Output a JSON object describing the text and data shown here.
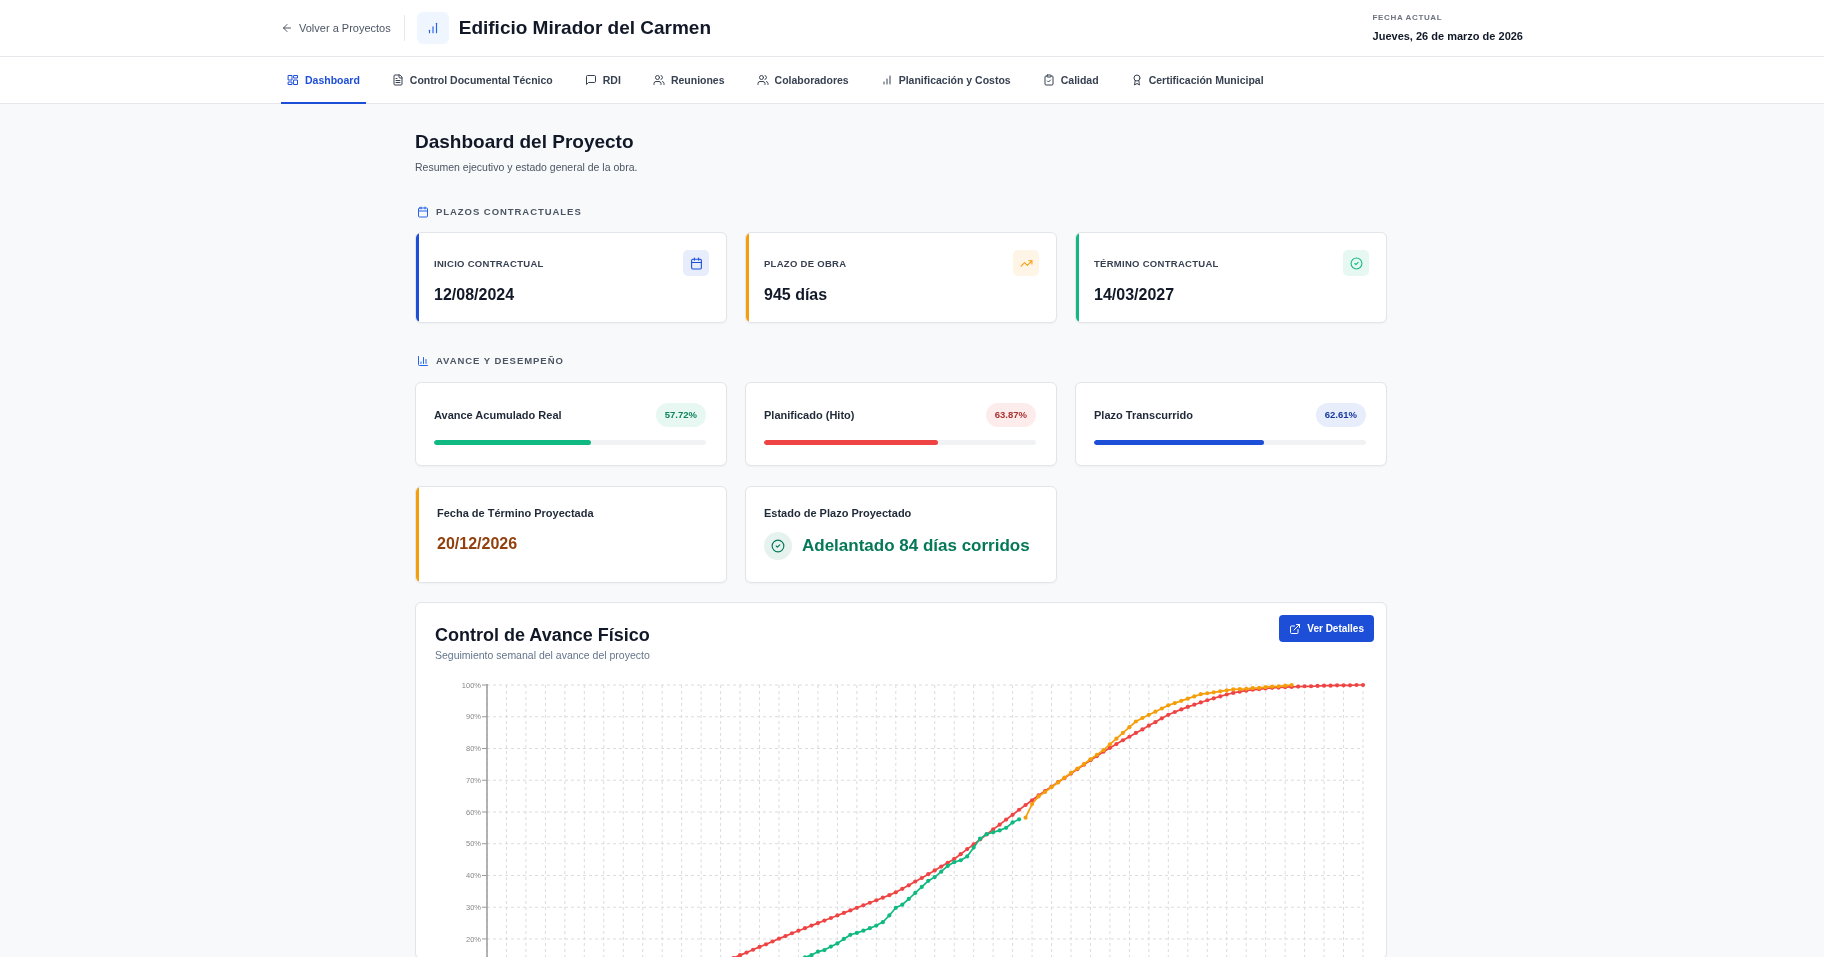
{
  "header": {
    "back_link": "Volver a Proyectos",
    "title": "Edificio Mirador del Carmen",
    "date_label": "FECHA ACTUAL",
    "date": "Jueves, 26 de marzo de 2026"
  },
  "tabs": [
    {
      "label": "Dashboard",
      "selected": true
    },
    {
      "label": "Control Documental Técnico",
      "selected": false
    },
    {
      "label": "RDI",
      "selected": false
    },
    {
      "label": "Reuniones",
      "selected": false
    },
    {
      "label": "Colaboradores",
      "selected": false
    },
    {
      "label": "Planificación y Costos",
      "selected": false
    },
    {
      "label": "Calidad",
      "selected": false
    },
    {
      "label": "Certificación Municipal",
      "selected": false
    }
  ],
  "page": {
    "title": "Dashboard del Proyecto",
    "subtitle": "Resumen ejecutivo y estado general de la obra."
  },
  "contract_terms": {
    "heading": "PLAZOS CONTRACTUALES",
    "cards": [
      {
        "label": "INICIO CONTRACTUAL",
        "value": "12/08/2024",
        "color": "#1d4ed8"
      },
      {
        "label": "PLAZO DE OBRA",
        "value": "945 días",
        "color": "#f59e0b"
      },
      {
        "label": "TÉRMINO CONTRACTUAL",
        "value": "14/03/2027",
        "color": "#10b981"
      }
    ]
  },
  "performance": {
    "heading": "AVANCE Y DESEMPEÑO",
    "metrics": [
      {
        "label": "Avance Acumulado Real",
        "reading": "57.72%",
        "level": 0.5772,
        "color": "#10b981"
      },
      {
        "label": "Planificado (Hito)",
        "reading": "63.87%",
        "level": 0.6387,
        "color": "#ef4444"
      },
      {
        "label": "Plazo Transcurrido",
        "reading": "62.61%",
        "level": 0.6261,
        "color": "#1d4ed8"
      }
    ],
    "projection": [
      {
        "kind": "date",
        "label": "Fecha de Término Proyectada",
        "value": "20/12/2026",
        "color": "#f59e0b"
      },
      {
        "kind": "status",
        "label": "Estado de Plazo Proyectado",
        "value": "Adelantado 84 días corridos",
        "color": "#047857"
      }
    ]
  },
  "progress_chart": {
    "title": "Control de Avance Físico",
    "subtitle": "Seguimiento semanal del avance del proyecto",
    "button": "Ver Detalles",
    "chart_data": {
      "type": "line",
      "grid": true,
      "categories": [
        null,
        null,
        null,
        null,
        null,
        null,
        null,
        null,
        null,
        null,
        null,
        null,
        null,
        null,
        null,
        null,
        null,
        null,
        null,
        null,
        null,
        null,
        null,
        null,
        null,
        null,
        null,
        null,
        null,
        null,
        null,
        null,
        null,
        null,
        null,
        null,
        null,
        null,
        null,
        null,
        null,
        null,
        null,
        null,
        null,
        null,
        null,
        null,
        null,
        null,
        null,
        null,
        null,
        null,
        null,
        null,
        null,
        null,
        null,
        null,
        null,
        null,
        null,
        null,
        null,
        null,
        null,
        null,
        null,
        null,
        null,
        null,
        null,
        null,
        null,
        null,
        null,
        null,
        null,
        null,
        null,
        null,
        null,
        null,
        null,
        null,
        null,
        null,
        null,
        null,
        null,
        null,
        null,
        null,
        null,
        null,
        null,
        null,
        null,
        null,
        null,
        null,
        null,
        null,
        null,
        null,
        null,
        null,
        null,
        null,
        null,
        null,
        null,
        null,
        null,
        null,
        null,
        null,
        null,
        null,
        null,
        null,
        null,
        null,
        null,
        null,
        null,
        null,
        null,
        null,
        null,
        null,
        null,
        null,
        null,
        null
      ],
      "ylim": [
        14,
        100
      ],
      "yticks": [
        {
          "value": 20,
          "label": "20%"
        },
        {
          "value": 30,
          "label": "30%"
        },
        {
          "value": 40,
          "label": "40%"
        },
        {
          "value": 50,
          "label": "50%"
        },
        {
          "value": 60,
          "label": "60%"
        },
        {
          "value": 70,
          "label": "70%"
        },
        {
          "value": 80,
          "label": "80%"
        },
        {
          "value": 90,
          "label": "90%"
        },
        {
          "value": 100,
          "label": "100%"
        }
      ],
      "series": [
        {
          "color": "#ef4444",
          "values": [
            null,
            null,
            null,
            null,
            null,
            null,
            null,
            null,
            null,
            null,
            null,
            null,
            null,
            null,
            null,
            null,
            null,
            null,
            null,
            null,
            null,
            null,
            null,
            null,
            null,
            null,
            null,
            null,
            null,
            null,
            null,
            null,
            null,
            null,
            null,
            null,
            null,
            null,
            14.0,
            14.9,
            15.7,
            16.6,
            17.5,
            18.3,
            19.2,
            20.1,
            20.9,
            21.8,
            22.6,
            23.4,
            24.2,
            25.0,
            25.8,
            26.6,
            27.4,
            28.2,
            29.0,
            29.8,
            30.6,
            31.4,
            32.2,
            33.0,
            33.8,
            34.7,
            35.8,
            36.9,
            38.1,
            39.2,
            40.4,
            41.6,
            42.8,
            44.0,
            45.2,
            46.7,
            48.3,
            49.8,
            51.4,
            52.9,
            54.5,
            56.0,
            57.6,
            59.1,
            60.7,
            62.2,
            63.7,
            65.2,
            66.6,
            68.0,
            69.4,
            70.7,
            72.1,
            73.5,
            74.9,
            76.3,
            77.6,
            79.0,
            80.2,
            81.4,
            82.6,
            83.7,
            84.9,
            86.0,
            87.2,
            88.3,
            89.5,
            90.6,
            91.5,
            92.3,
            93.1,
            93.8,
            94.5,
            95.2,
            95.8,
            96.4,
            97.0,
            97.5,
            97.9,
            98.2,
            98.5,
            98.7,
            98.9,
            99.1,
            99.2,
            99.3,
            99.4,
            99.5,
            99.6,
            99.6,
            99.7,
            99.8,
            99.8,
            99.9,
            99.9,
            99.9,
            100.0,
            100.0
          ]
        },
        {
          "color": "#10b981",
          "values": [
            null,
            null,
            null,
            null,
            null,
            null,
            null,
            null,
            null,
            null,
            null,
            null,
            null,
            null,
            null,
            null,
            null,
            null,
            null,
            null,
            null,
            null,
            null,
            null,
            null,
            null,
            null,
            null,
            null,
            null,
            null,
            null,
            null,
            null,
            null,
            null,
            null,
            null,
            null,
            null,
            null,
            null,
            null,
            null,
            null,
            null,
            null,
            null,
            null,
            14.2,
            14.9,
            16.0,
            16.5,
            17.6,
            18.6,
            20.0,
            21.3,
            21.9,
            22.6,
            23.4,
            24.2,
            25.3,
            27.4,
            29.8,
            30.8,
            32.6,
            34.5,
            36.4,
            38.3,
            39.5,
            41.2,
            43.0,
            44.2,
            44.8,
            46.0,
            48.8,
            51.6,
            53.0,
            53.6,
            54.2,
            55.0,
            56.7,
            57.7,
            null,
            null,
            null,
            null,
            null,
            null,
            null,
            null,
            null,
            null,
            null,
            null,
            null,
            null,
            null,
            null,
            null,
            null,
            null,
            null,
            null,
            null,
            null,
            null,
            null,
            null,
            null,
            null,
            null,
            null,
            null,
            null,
            null,
            null,
            null,
            null,
            null,
            null,
            null,
            null,
            null,
            null,
            null,
            null,
            null,
            null,
            null,
            null,
            null,
            null,
            null,
            null,
            null
          ]
        },
        {
          "color": "#f59e0b",
          "values": [
            null,
            null,
            null,
            null,
            null,
            null,
            null,
            null,
            null,
            null,
            null,
            null,
            null,
            null,
            null,
            null,
            null,
            null,
            null,
            null,
            null,
            null,
            null,
            null,
            null,
            null,
            null,
            null,
            null,
            null,
            null,
            null,
            null,
            null,
            null,
            null,
            null,
            null,
            null,
            null,
            null,
            null,
            null,
            null,
            null,
            null,
            null,
            null,
            null,
            null,
            null,
            null,
            null,
            null,
            null,
            null,
            null,
            null,
            null,
            null,
            null,
            null,
            null,
            null,
            null,
            null,
            null,
            null,
            null,
            null,
            null,
            null,
            null,
            null,
            null,
            null,
            null,
            null,
            null,
            null,
            null,
            null,
            null,
            58.2,
            62.5,
            64.9,
            66.3,
            67.8,
            69.3,
            70.8,
            72.3,
            73.7,
            75.1,
            76.6,
            78.0,
            79.5,
            81.3,
            83.1,
            84.9,
            86.7,
            88.5,
            89.6,
            90.6,
            91.6,
            92.6,
            93.6,
            94.3,
            95.0,
            95.7,
            96.4,
            97.1,
            97.4,
            97.7,
            98.0,
            98.3,
            98.6,
            98.7,
            98.8,
            99.0,
            99.1,
            99.3,
            99.5,
            99.6,
            99.8,
            100.0,
            null,
            null,
            null,
            null,
            null,
            null,
            null,
            null,
            null,
            null,
            null
          ]
        }
      ]
    }
  }
}
